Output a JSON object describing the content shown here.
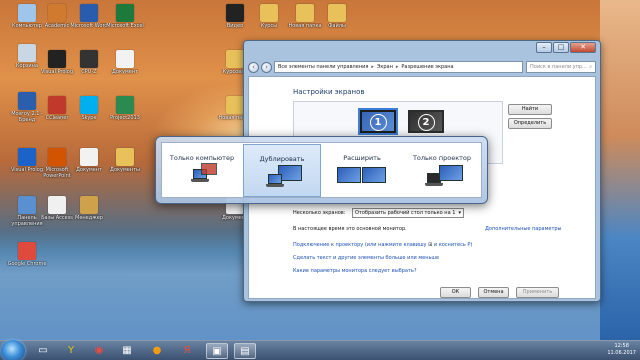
{
  "desktop": {
    "icons": [
      {
        "label": "Компьютер",
        "color": "#9fc6ea"
      },
      {
        "label": "Корзина",
        "color": "#c9d6e3"
      },
      {
        "label": "Мозгоу 2.1 - Бренд",
        "color": "#2b5fad"
      },
      {
        "label": "Visual Prolog",
        "color": "#1b63c8"
      },
      {
        "label": "Панель управления",
        "color": "#5a8fd0"
      },
      {
        "label": "Google Chrome",
        "color": "#e04a3c"
      },
      {
        "label": "Academic",
        "color": "#d07a30"
      },
      {
        "label": "Visual Prolog",
        "color": "#222222"
      },
      {
        "label": "CCleaner",
        "color": "#c0392b"
      },
      {
        "label": "Microsoft PowerPoint",
        "color": "#d35400"
      },
      {
        "label": "Базы Access",
        "color": "#f0f0f0"
      },
      {
        "label": "Microsoft Word",
        "color": "#2a5cae"
      },
      {
        "label": "CPU-Z",
        "color": "#333333"
      },
      {
        "label": "Skype",
        "color": "#00aff0"
      },
      {
        "label": "Документ",
        "color": "#f2f2f2"
      },
      {
        "label": "Менеджер",
        "color": "#cfa14b"
      },
      {
        "label": "Microsoft Excel",
        "color": "#1e7a3c"
      },
      {
        "label": "Документ",
        "color": "#f2f2f2"
      },
      {
        "label": "Project2013",
        "color": "#2a8a4f"
      },
      {
        "label": "Документы",
        "color": "#e8c15a"
      },
      {
        "label": "Видео",
        "color": "#222222"
      },
      {
        "label": "Курсовая",
        "color": "#e8c15a"
      },
      {
        "label": "Новая папка",
        "color": "#e8c15a"
      },
      {
        "label": "СВОДКА",
        "color": "#e8c15a"
      },
      {
        "label": "Документ",
        "color": "#f2f2f2"
      },
      {
        "label": "Курсы",
        "color": "#e8c15a"
      },
      {
        "label": "Учеба",
        "color": "#e8c15a"
      },
      {
        "label": "Новая папка",
        "color": "#e8c15a"
      },
      {
        "label": "Файлы",
        "color": "#e8c15a"
      }
    ]
  },
  "window": {
    "address": {
      "part1": "Все элементы панели управления",
      "part2": "Экран",
      "part3": "Разрешение экрана"
    },
    "search_placeholder": "Поиск в панели упр...",
    "heading": "Настройки экранов",
    "monitor1": "1",
    "monitor2": "2",
    "find_button": "Найти",
    "identify_button": "Определить",
    "multiple_label": "Несколько экранов:",
    "multiple_value": "Отобразить рабочий стол только на 1",
    "current_main": "В настоящее время это основной монитор.",
    "advanced_link": "Дополнительные параметры",
    "link1": "Подключение к проектору (или нажмите клавишу",
    "link1b": "и коснитесь P)",
    "link2": "Сделать текст и другие элементы больше или меньше",
    "link3": "Какие параметры монитора следует выбрать?",
    "ok": "ОК",
    "cancel": "Отмена",
    "apply": "Применить"
  },
  "switcher": {
    "options": [
      {
        "label": "Только компьютер"
      },
      {
        "label": "Дублировать"
      },
      {
        "label": "Расширить"
      },
      {
        "label": "Только проектор"
      }
    ],
    "selected_index": 1
  },
  "taskbar": {
    "time": "12:58",
    "date": "11.06.2017",
    "apps": [
      "folder-icon",
      "yandex-icon",
      "chrome-icon",
      "gallery-icon",
      "ok-icon",
      "yandex-browser-icon",
      "display-icon",
      "switch-icon"
    ]
  }
}
